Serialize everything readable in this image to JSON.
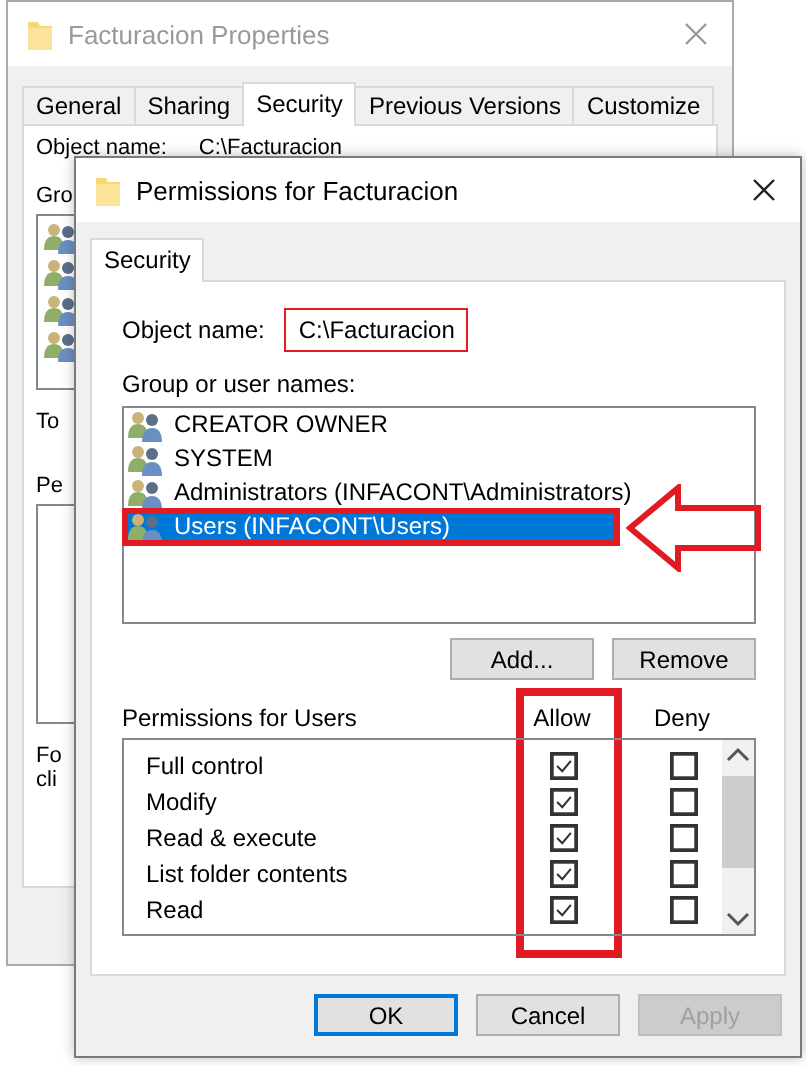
{
  "back_window": {
    "title": "Facturacion Properties",
    "tabs": [
      {
        "label": "General",
        "selected": false
      },
      {
        "label": "Sharing",
        "selected": false
      },
      {
        "label": "Security",
        "selected": true
      },
      {
        "label": "Previous Versions",
        "selected": false
      },
      {
        "label": "Customize",
        "selected": false
      }
    ],
    "object_name_label": "Object name:",
    "object_name": "C:\\Facturacion",
    "cut_labels": [
      "Gro",
      "To",
      "Pe",
      "Fo",
      "cli"
    ]
  },
  "dialog": {
    "title": "Permissions for Facturacion",
    "tabs": [
      {
        "label": "Security",
        "selected": true
      }
    ],
    "object_name_label": "Object name:",
    "object_name": "C:\\Facturacion",
    "object_name_highlighted": true,
    "group_label": "Group or user names:",
    "principals": [
      {
        "name": "CREATOR OWNER",
        "selected": false,
        "highlighted": false
      },
      {
        "name": "SYSTEM",
        "selected": false,
        "highlighted": false
      },
      {
        "name": "Administrators (INFACONT\\Administrators)",
        "selected": false,
        "highlighted": false
      },
      {
        "name": "Users (INFACONT\\Users)",
        "selected": true,
        "highlighted": true
      }
    ],
    "buttons": [
      "Add...",
      "Remove"
    ],
    "permissions_label": "Permissions for Users",
    "columns": [
      {
        "label": "Allow",
        "highlighted": true
      },
      {
        "label": "Deny",
        "highlighted": false
      }
    ],
    "permissions": [
      {
        "name": "Full control",
        "allow": true,
        "deny": false
      },
      {
        "name": "Modify",
        "allow": true,
        "deny": false
      },
      {
        "name": "Read & execute",
        "allow": true,
        "deny": false
      },
      {
        "name": "List folder contents",
        "allow": true,
        "deny": false
      },
      {
        "name": "Read",
        "allow": true,
        "deny": false
      }
    ],
    "footer_buttons": [
      {
        "label": "OK",
        "kind": "default",
        "disabled": false
      },
      {
        "label": "Cancel",
        "kind": "normal",
        "disabled": false
      },
      {
        "label": "Apply",
        "kind": "normal",
        "disabled": true
      }
    ]
  }
}
